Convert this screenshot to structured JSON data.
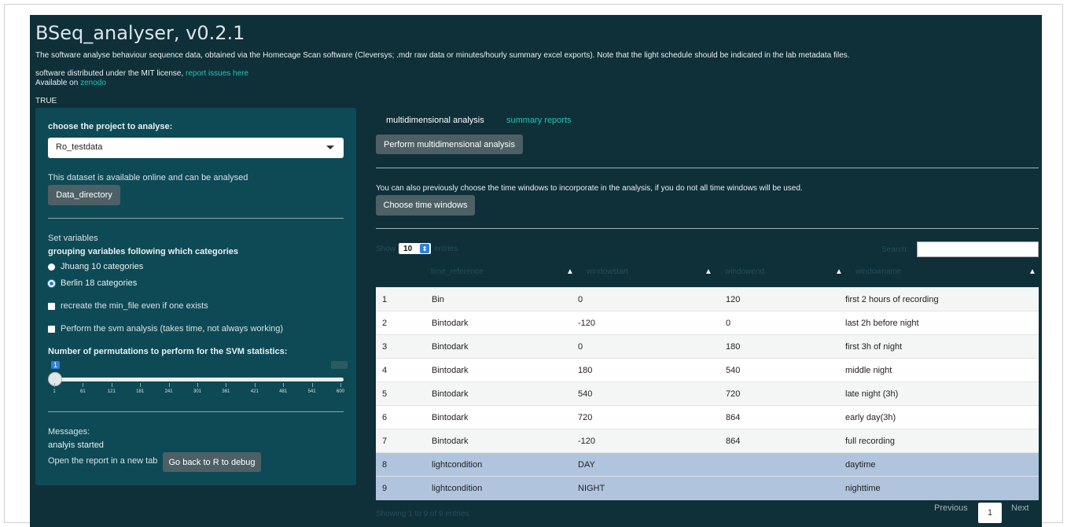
{
  "app": {
    "title": "BSeq_analyser, v0.2.1",
    "description": "The software analyse behaviour sequence data, obtained via the Homecage Scan software (Cleversys; .mdr raw data or minutes/hourly summary excel exports). Note that the light schedule should be indicated in the lab metadata files.",
    "license_text": "software distributed under the MIT license, ",
    "report_link": "report issues here",
    "available_text": "Available on ",
    "zenodo_link": "zenodo",
    "true_text": "TRUE"
  },
  "sidebar": {
    "project_label": "choose the project to analyse:",
    "project_value": "Ro_testdata",
    "available_msg": "This dataset is available online and can be analysed",
    "data_dir_button": "Data_directory",
    "set_variables": "Set variables",
    "grouping_label": "grouping variables following which categories",
    "radio_options": [
      "Jhuang 10 categories",
      "Berlin 18 categories"
    ],
    "radio_selected": "Berlin 18 categories",
    "checkbox_min_file": "recreate the min_file even if one exists",
    "checkbox_svm": "Perform the svm analysis (takes time, not always working)",
    "permutations_label": "Number of permutations to perform for the SVM statistics:",
    "slider": {
      "value": "1",
      "max_value": "600",
      "min": 1,
      "max": 600,
      "ticks": [
        "1",
        "61",
        "121",
        "181",
        "241",
        "301",
        "361",
        "421",
        "481",
        "541",
        "600"
      ]
    },
    "messages_label": "Messages:",
    "messages_value": "analyis started",
    "open_report_link": "Open the report in a new tab",
    "debug_button": "Go back to R to debug"
  },
  "main": {
    "tabs": [
      "multidimensional analysis",
      "summary reports"
    ],
    "active_tab": "multidimensional analysis",
    "perform_button": "Perform multidimensional analysis",
    "time_window_text": "You can also previously choose the time windows to incorporate in the analysis, if you do not all time windows will be used.",
    "choose_button": "Choose time windows",
    "table": {
      "show_label": "Show",
      "entries_value": "10",
      "entries_label": "entries",
      "search_label": "Search:",
      "columns": [
        "time_reference",
        "windowstart",
        "windowend",
        "windowname"
      ],
      "rows": [
        [
          "1",
          "Bin",
          "0",
          "120",
          "first 2 hours of recording"
        ],
        [
          "2",
          "Bintodark",
          "-120",
          "0",
          "last 2h before night"
        ],
        [
          "3",
          "Bintodark",
          "0",
          "180",
          "first 3h of night"
        ],
        [
          "4",
          "Bintodark",
          "180",
          "540",
          "middle night"
        ],
        [
          "5",
          "Bintodark",
          "540",
          "720",
          "late night (3h)"
        ],
        [
          "6",
          "Bintodark",
          "720",
          "864",
          "early day(3h)"
        ],
        [
          "7",
          "Bintodark",
          "-120",
          "864",
          "full recording"
        ],
        [
          "8",
          "lightcondition",
          "DAY",
          "",
          "daytime"
        ],
        [
          "9",
          "lightcondition",
          "NIGHT",
          "",
          "nighttime"
        ]
      ],
      "selected_rows": [
        8,
        9
      ],
      "info": "Showing 1 to 9 of 9 entries",
      "prev": "Previous",
      "page": "1",
      "next": "Next"
    }
  },
  "colors": {
    "background": "#0f2f39",
    "sidebar": "#0e4a55",
    "link": "#20c6b6",
    "button": "#4d6066",
    "selected_row": "#b0c4de"
  }
}
